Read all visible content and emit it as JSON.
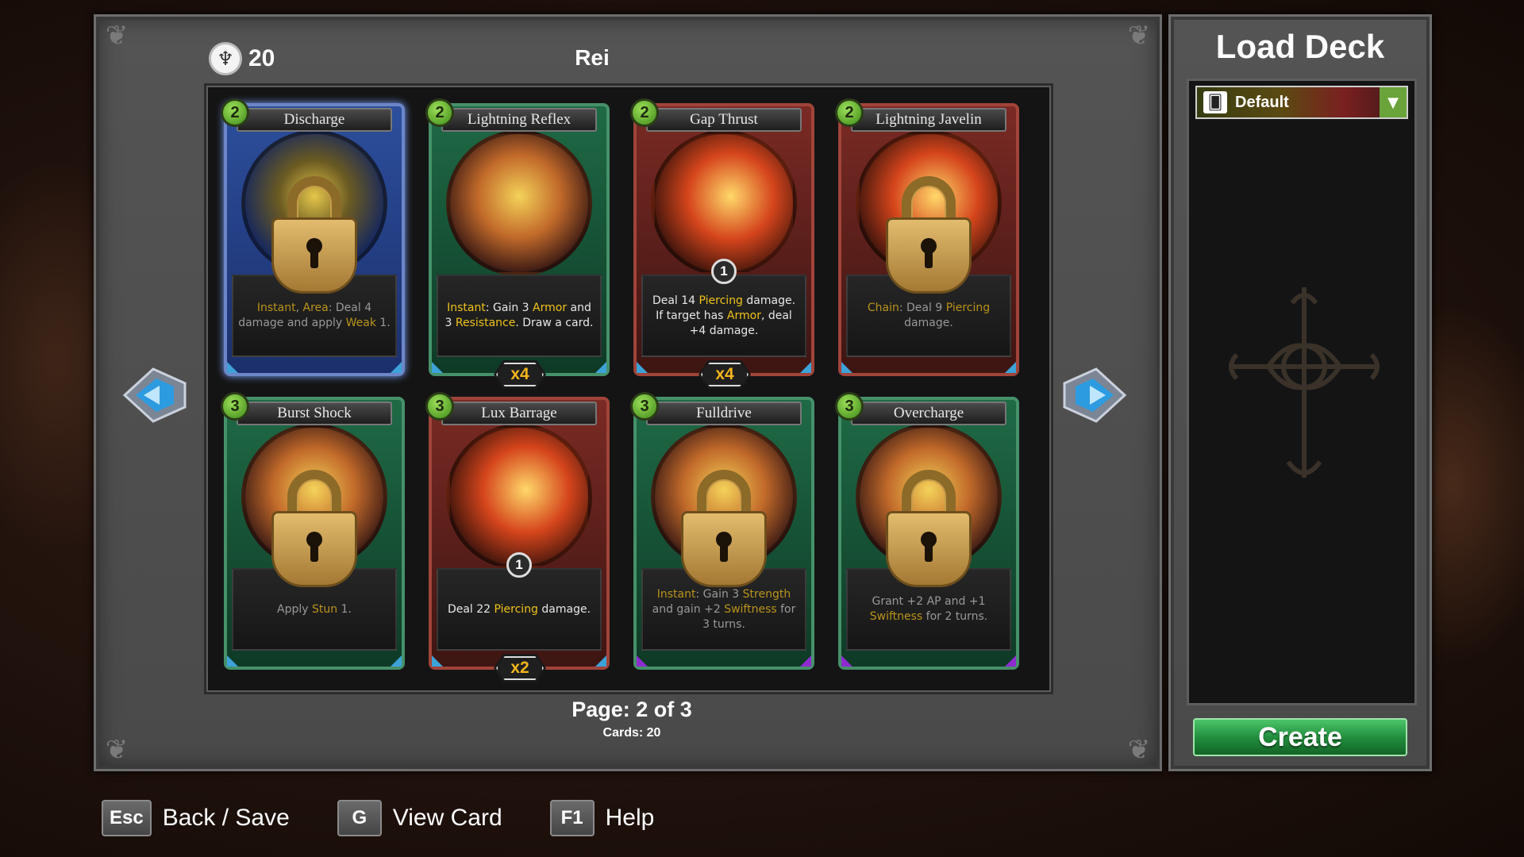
{
  "header": {
    "currency_icon": "cards-coin-icon",
    "currency_value": "20",
    "character_name": "Rei"
  },
  "cards": [
    {
      "name": "Discharge",
      "cost": "2",
      "color": "blue",
      "locked": true,
      "desc_html": "<span class='kw'>Instant</span>, <span class='kw'>Area</span>: Deal 4 damage and apply <span class='kw'>Weak</span> 1.",
      "qty": "",
      "badge": ""
    },
    {
      "name": "Lightning Reflex",
      "cost": "2",
      "color": "green",
      "locked": false,
      "desc_html": "<span class='kw'>Instant</span>: Gain 3 <span class='kw'>Armor</span> and 3 <span class='kw'>Resistance</span>. Draw a card.",
      "qty": "x4",
      "badge": ""
    },
    {
      "name": "Gap Thrust",
      "cost": "2",
      "color": "red",
      "locked": false,
      "desc_html": "Deal 14 <span class='kw'>Piercing</span> damage. If target has <span class='kw'>Armor</span>, deal +4 damage.",
      "qty": "x4",
      "badge": "1"
    },
    {
      "name": "Lightning Javelin",
      "cost": "2",
      "color": "red",
      "locked": true,
      "desc_html": "<span class='kw'>Chain</span>: Deal 9 <span class='kw'>Piercing</span> damage.",
      "qty": "",
      "badge": ""
    },
    {
      "name": "Burst Shock",
      "cost": "3",
      "color": "green",
      "locked": true,
      "desc_html": "Apply <span class='kw'>Stun</span> 1.",
      "qty": "",
      "badge": ""
    },
    {
      "name": "Lux Barrage",
      "cost": "3",
      "color": "red",
      "locked": false,
      "desc_html": "Deal 22 <span class='kw'>Piercing</span> damage.",
      "qty": "x2",
      "badge": "1"
    },
    {
      "name": "Fulldrive",
      "cost": "3",
      "color": "green",
      "locked": true,
      "desc_html": "<span class='kw'>Instant</span>: Gain 3 <span class='kw'>Strength</span> and gain +2 <span class='kw'>Swiftness</span> for 3 turns.",
      "qty": "",
      "badge": ""
    },
    {
      "name": "Overcharge",
      "cost": "3",
      "color": "green",
      "locked": true,
      "desc_html": "Grant +2 AP and +1 <span class='kw'>Swiftness</span> for 2 turns.",
      "qty": "",
      "badge": ""
    }
  ],
  "pagination": {
    "page_label": "Page: 2 of 3",
    "cards_label": "Cards: 20"
  },
  "side_panel": {
    "title": "Load Deck",
    "selected_deck": "Default",
    "create_label": "Create"
  },
  "hints": [
    {
      "key": "Esc",
      "label": "Back / Save"
    },
    {
      "key": "G",
      "label": "View Card"
    },
    {
      "key": "F1",
      "label": "Help"
    }
  ],
  "colors": {
    "keyword": "#f0c31c",
    "create": "#1f8a3a",
    "cost": "#6fc22f",
    "qty": "#f3b51d"
  }
}
